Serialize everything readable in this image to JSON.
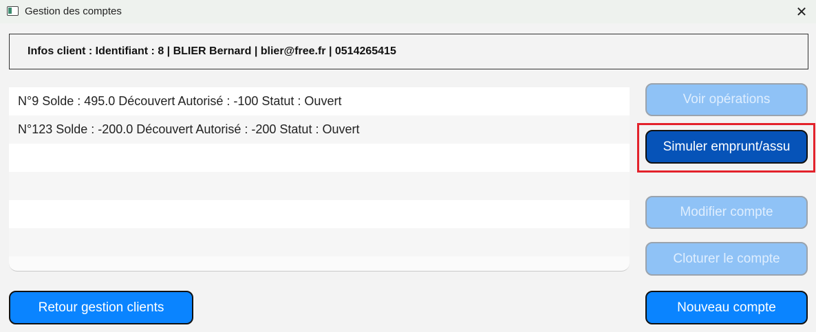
{
  "window": {
    "title": "Gestion des comptes",
    "close_symbol": "✕"
  },
  "client_info": "Infos client : Identifiant : 8 | BLIER Bernard | blier@free.fr | 0514265415",
  "accounts": [
    "N°9  Solde : 495.0  Découvert Autorisé : -100  Statut :  Ouvert",
    "N°123  Solde : -200.0  Découvert Autorisé : -200  Statut :  Ouvert",
    "",
    "",
    "",
    ""
  ],
  "buttons": {
    "voir_operations": "Voir opérations",
    "simuler": "Simuler emprunt/assu",
    "modifier": "Modifier compte",
    "cloturer": "Cloturer le compte",
    "retour": "Retour gestion clients",
    "nouveau": "Nouveau compte"
  },
  "colors": {
    "primary": "#0a84ff",
    "active": "#0653b8",
    "disabled": "#8fc2f6",
    "highlight": "#e3222b"
  }
}
